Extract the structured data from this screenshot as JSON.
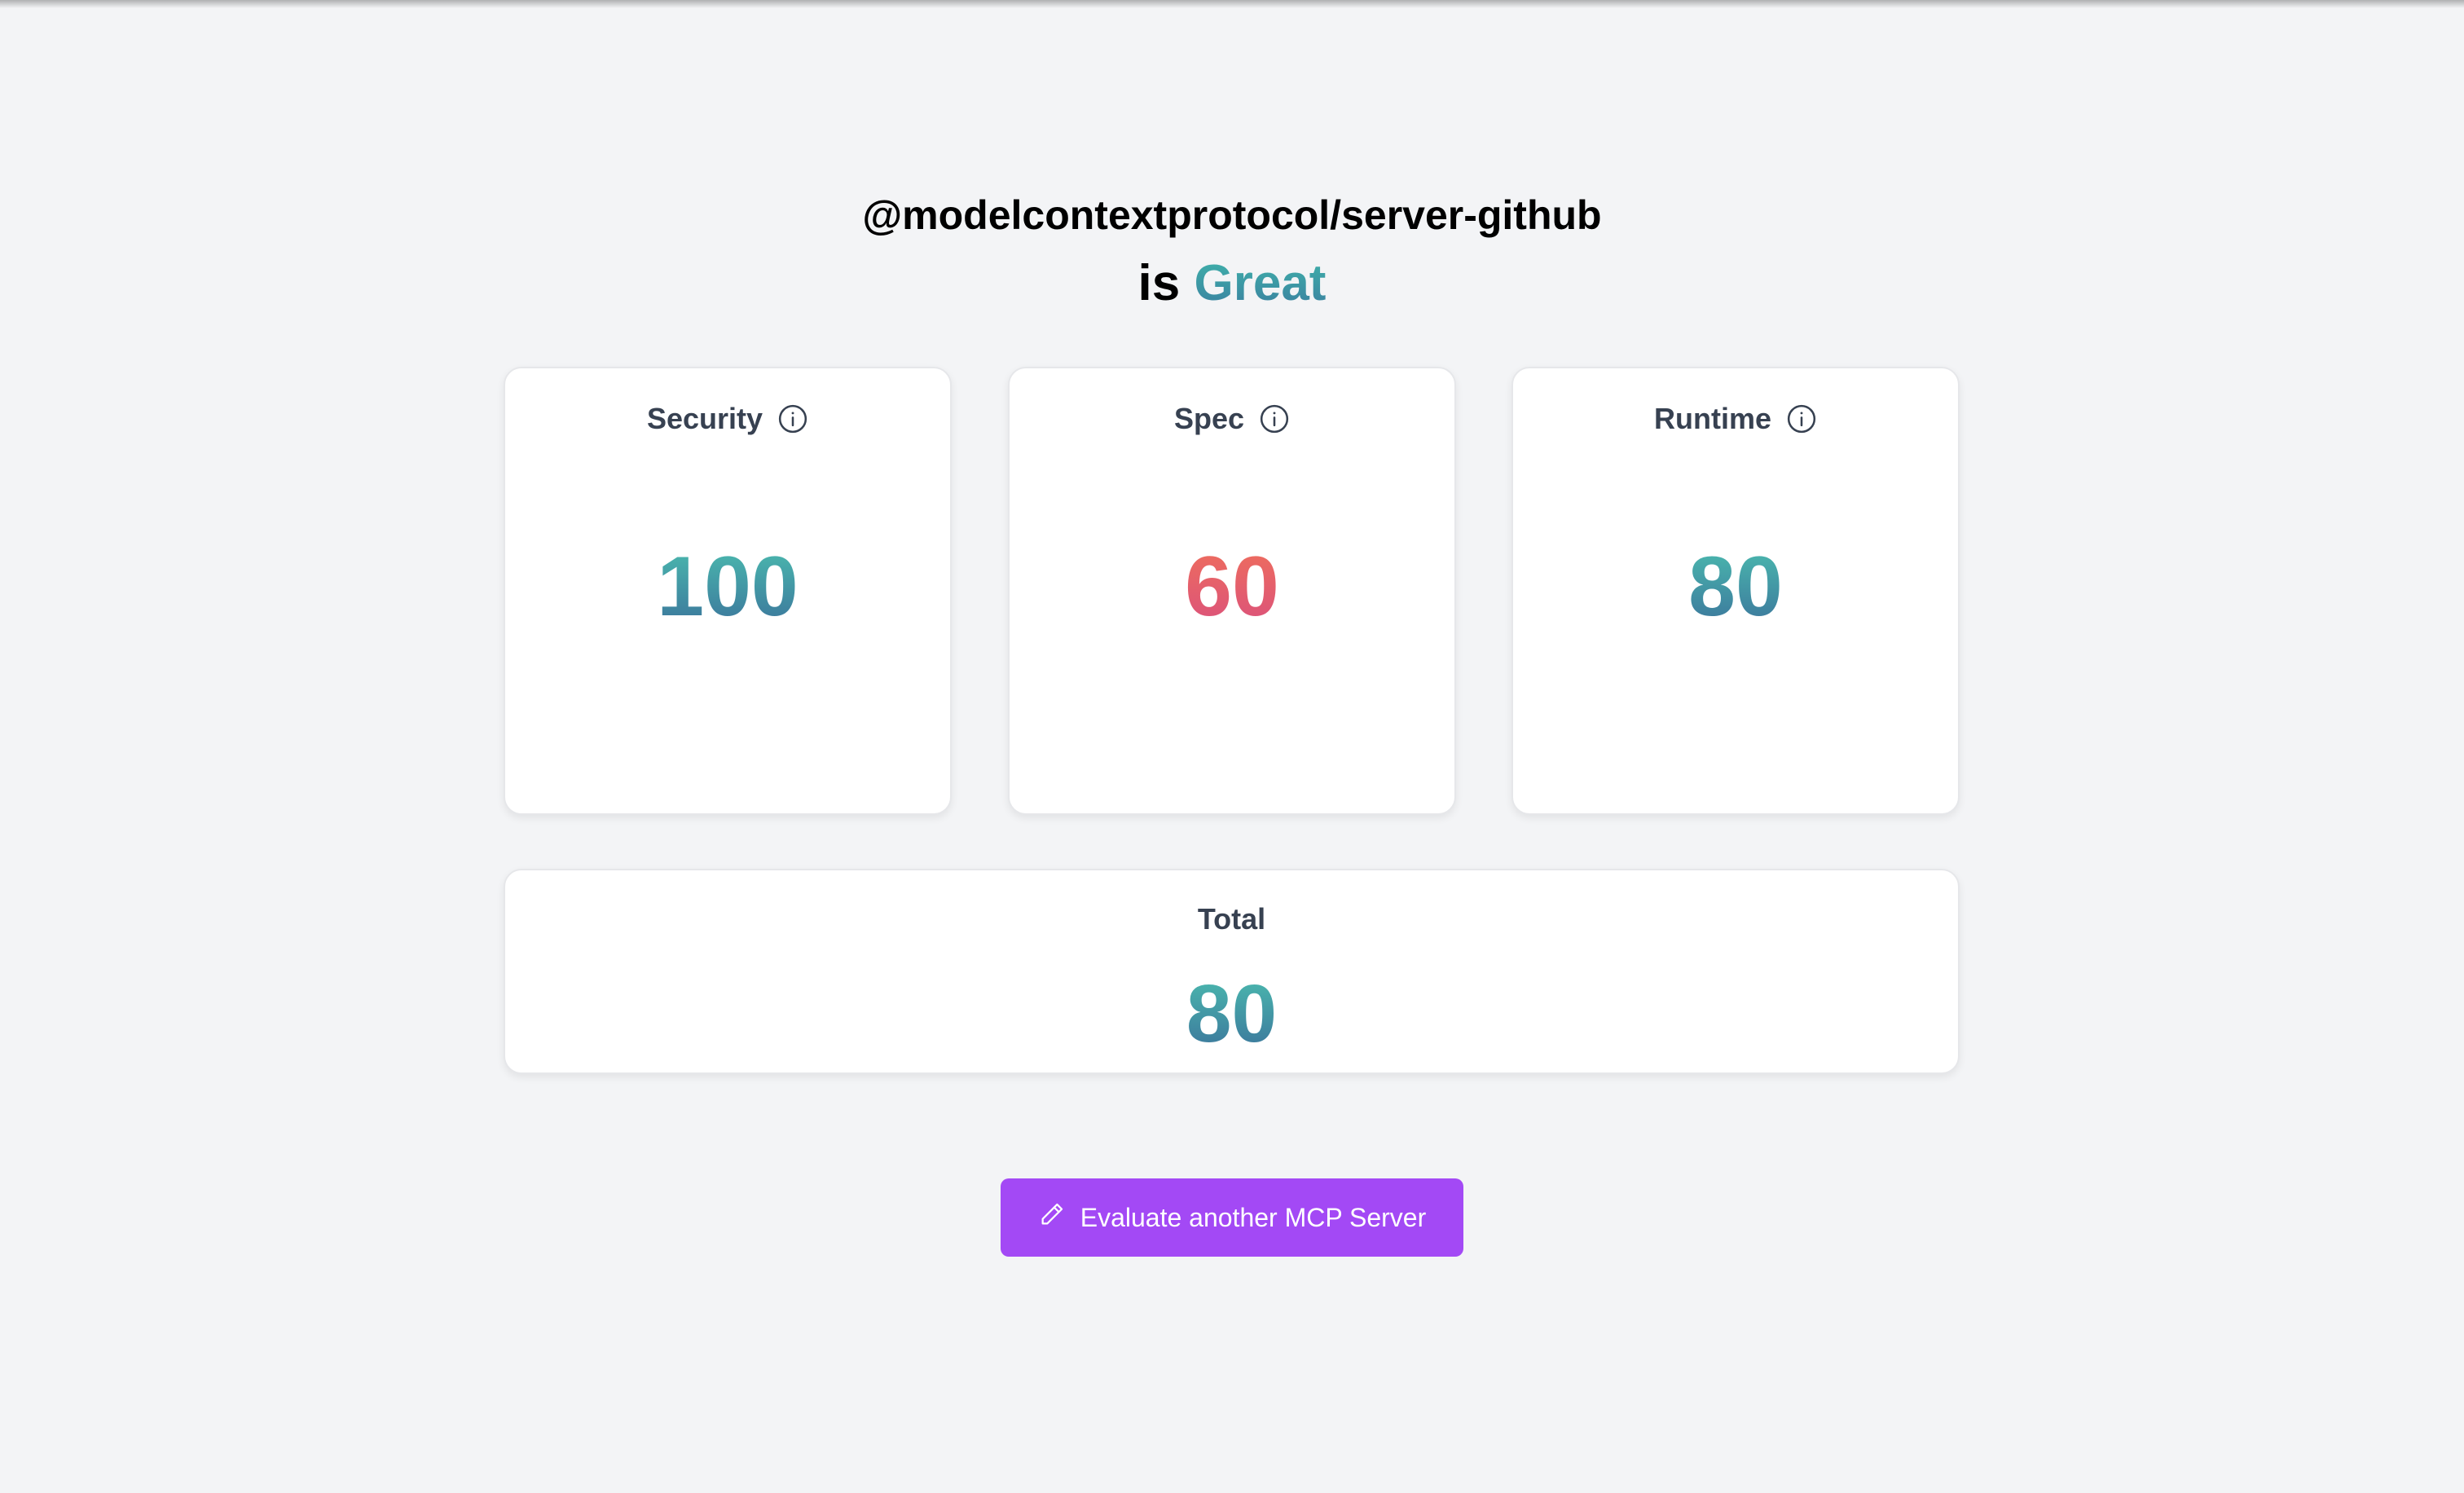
{
  "result": {
    "server_name": "@modelcontextprotocol/server-github",
    "verdict_prefix": "is",
    "verdict": "Great"
  },
  "cards": {
    "security": {
      "label": "Security",
      "score": "100",
      "icon": "info-icon"
    },
    "spec": {
      "label": "Spec",
      "score": "60",
      "icon": "info-icon"
    },
    "runtime": {
      "label": "Runtime",
      "score": "80",
      "icon": "info-icon"
    }
  },
  "total": {
    "label": "Total",
    "score": "80"
  },
  "action": {
    "label": "Evaluate another MCP Server",
    "icon": "pencil-icon"
  },
  "colors": {
    "good_gradient": [
      "#4cc0b0",
      "#3a6f9a"
    ],
    "warn_gradient": [
      "#f0705a",
      "#d94f7e"
    ],
    "button": "#a349f5",
    "background": "#f3f4f6"
  }
}
